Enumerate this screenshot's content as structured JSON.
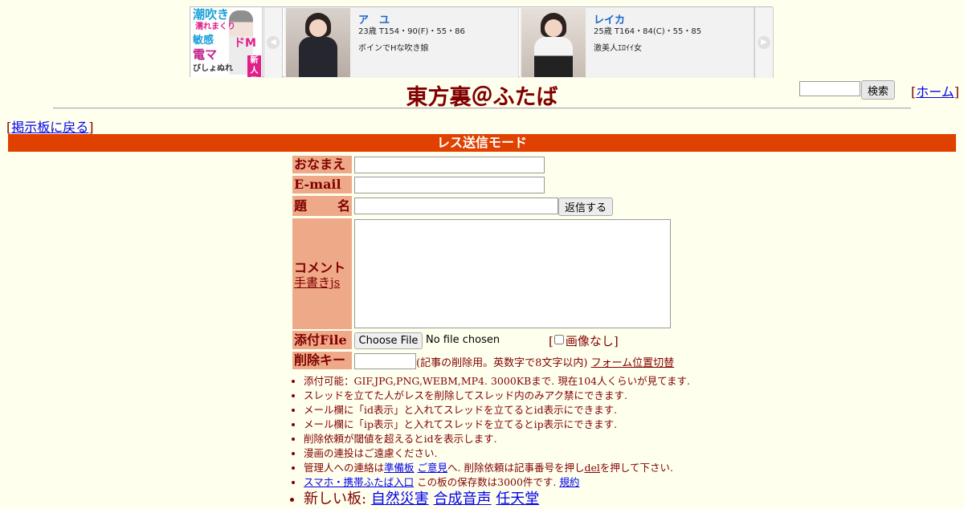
{
  "banner": {
    "ad": {
      "line1": "潮吹き",
      "line2": "濡れまくり",
      "line3": "敏感",
      "line4": "電マ",
      "line5": "ドM",
      "line6": "びしょぬれ",
      "badge": "新人秘書"
    },
    "profiles": [
      {
        "name": "ア　ユ",
        "stats": "23歳 T154・90(F)・55・86",
        "desc": "ボインでHな吹き娘"
      },
      {
        "name": "レイカ",
        "stats": "25歳 T164・84(C)・55・85",
        "desc": "激美人ｴﾛｲｲ女"
      }
    ],
    "arrow_left": "◀",
    "arrow_right": "▶"
  },
  "title": "東方裏＠ふたば",
  "search": {
    "button": "検索",
    "value": ""
  },
  "home": {
    "open": "[",
    "label": "ホーム",
    "close": "]"
  },
  "back": {
    "open": "[",
    "label": "掲示板に戻る",
    "close": "]"
  },
  "mode_bar": "レス送信モード",
  "form": {
    "name_label": "おなまえ",
    "email_label": "E-mail",
    "subject_label_1": "題",
    "subject_label_2": "名",
    "reply_button": "返信する",
    "comment_label": "コメント",
    "handwrite_link": "手書きjs",
    "file_label": "添付File",
    "file_button": "Choose File",
    "file_status": "No file chosen",
    "noimage_open": "[",
    "noimage_label": "画像なし",
    "noimage_close": "]",
    "delkey_label": "削除キー",
    "delkey_note": "(記事の削除用。英数字で8文字以内)",
    "form_toggle_link": "フォーム位置切替"
  },
  "notes": [
    "添付可能：GIF,JPG,PNG,WEBM,MP4. 3000KBまで. 現在104人くらいが見てます.",
    "スレッドを立てた人がレスを削除してスレッド内のみアク禁にできます.",
    "メール欄に「id表示」と入れてスレッドを立てるとid表示にできます.",
    "メール欄に「ip表示」と入れてスレッドを立てるとip表示にできます.",
    "削除依頼が閾値を超えるとidを表示します.",
    "漫画の連投はご遠慮ください."
  ],
  "admin_note": {
    "prefix": "管理人への連絡は",
    "link1": "準備板",
    "link2": "ご意見",
    "middle": "へ. 削除依頼は記事番号を押し",
    "del": "del",
    "suffix": "を押して下さい."
  },
  "mobile_note": {
    "link": "スマホ・携帯ふたば入口",
    "text": " この板の保存数は3000件です. ",
    "rules": "規約"
  },
  "new_boards": {
    "prefix": "新しい板:",
    "boards": [
      "自然災害",
      "合成音声",
      "任天堂"
    ]
  },
  "colors": {
    "background": "#ffffee",
    "text": "#800000",
    "mode_bar": "#e04000",
    "label_bg": "#eeaa88"
  }
}
